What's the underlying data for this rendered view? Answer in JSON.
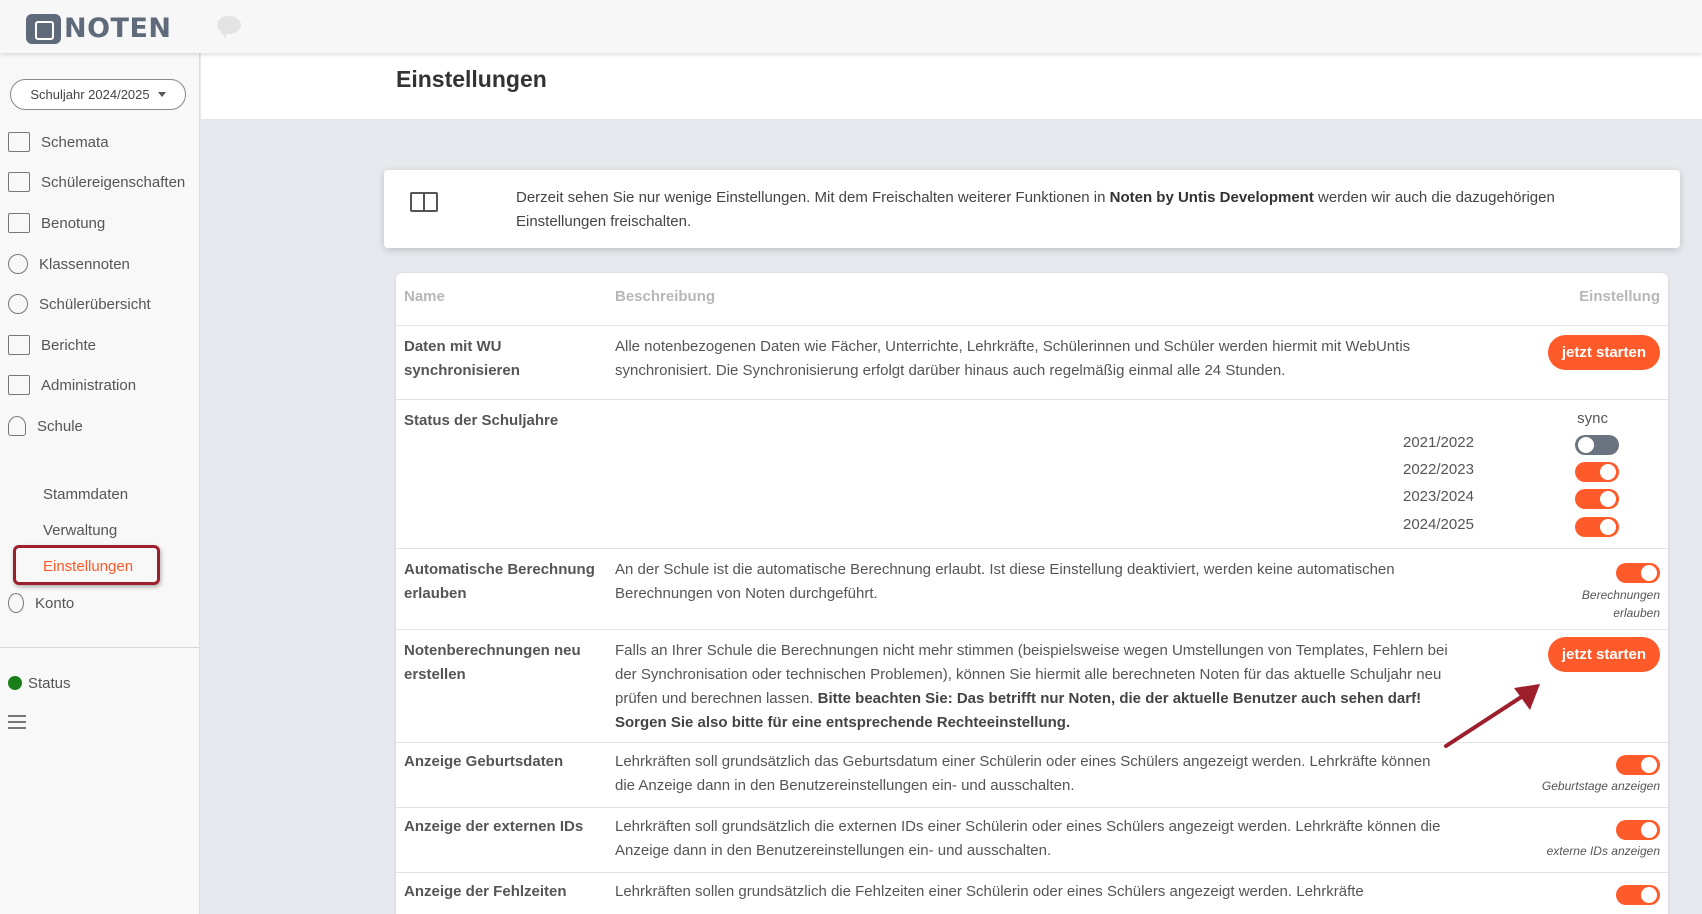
{
  "app": {
    "logo_text": "NOTEN"
  },
  "sidebar": {
    "school_year": "Schuljahr 2024/2025",
    "items": [
      {
        "label": "Schemata",
        "icon": "schemata-icon"
      },
      {
        "label": "Schülereigenschaften",
        "icon": "student-properties-icon"
      },
      {
        "label": "Benotung",
        "icon": "grading-icon"
      },
      {
        "label": "Klassennoten",
        "icon": "class-grades-icon"
      },
      {
        "label": "Schülerübersicht",
        "icon": "student-overview-icon"
      },
      {
        "label": "Berichte",
        "icon": "reports-icon"
      },
      {
        "label": "Administration",
        "icon": "administration-icon"
      },
      {
        "label": "Schule",
        "icon": "school-icon"
      }
    ],
    "sub_items": [
      "Stammdaten",
      "Verwaltung",
      "Einstellungen"
    ],
    "account": "Konto",
    "status": "Status",
    "status_color": "#1a7f1a"
  },
  "page": {
    "title": "Einstellungen",
    "info_text_1": "Derzeit sehen Sie nur wenige Einstellungen. Mit dem Freischalten weiterer Funktionen in ",
    "info_text_bold": "Noten by Untis Development",
    "info_text_2": " werden wir auch die dazugehörigen Einstellungen freischalten."
  },
  "table": {
    "headers": {
      "name": "Name",
      "description": "Beschreibung",
      "setting": "Einstellung"
    },
    "rows": [
      {
        "name": "Daten mit WU synchronisieren",
        "description": "Alle notenbezogenen Daten wie Fächer, Unterrichte, Lehrkräfte, Schülerinnen und Schüler werden hiermit mit WebUntis synchronisiert. Die Synchronisierung erfolgt darüber hinaus auch regelmäßig einmal alle 24 Stunden.",
        "button": "jetzt starten"
      },
      {
        "name": "Status der Schuljahre",
        "sync_label": "sync",
        "years": [
          {
            "year": "2021/2022",
            "on": false
          },
          {
            "year": "2022/2023",
            "on": true
          },
          {
            "year": "2023/2024",
            "on": true
          },
          {
            "year": "2024/2025",
            "on": true
          }
        ]
      },
      {
        "name": "Automatische Berechnung erlauben",
        "description": "An der Schule ist die automatische Berechnung erlaubt. Ist diese Einstellung deaktiviert, werden keine automatischen Berechnungen von Noten durchgeführt.",
        "toggle_label_1": "Berechnungen",
        "toggle_label_2": "erlauben",
        "on": true
      },
      {
        "name": "Notenberechnungen neu erstellen",
        "description": "Falls an Ihrer Schule die Berechnungen nicht mehr stimmen (beispielsweise wegen Umstellungen von Templates, Fehlern bei der Synchronisation oder technischen Problemen), können Sie hiermit alle berechneten Noten für das aktuelle Schuljahr neu prüfen und berechnen lassen. ",
        "description_bold": "Bitte beachten Sie: Das betrifft nur Noten, die der aktuelle Benutzer auch sehen darf! Sorgen Sie also bitte für eine entsprechende Rechteeinstellung.",
        "button": "jetzt starten"
      },
      {
        "name": "Anzeige Geburtsdaten",
        "description": "Lehrkräften soll grundsätzlich das Geburtsdatum einer Schülerin oder eines Schülers angezeigt werden. Lehrkräfte können die Anzeige dann in den Benutzereinstellungen ein- und ausschalten.",
        "toggle_label": "Geburtstage anzeigen",
        "on": true
      },
      {
        "name": "Anzeige der externen IDs",
        "description": "Lehrkräften soll grundsätzlich die externen IDs einer Schülerin oder eines Schülers angezeigt werden. Lehrkräfte können die Anzeige dann in den Benutzereinstellungen ein- und ausschalten.",
        "toggle_label": "externe IDs anzeigen",
        "on": true
      },
      {
        "name": "Anzeige der Fehlzeiten",
        "description": "Lehrkräften sollen grundsätzlich die Fehlzeiten einer Schülerin oder eines Schülers angezeigt werden. Lehrkräfte",
        "on": true
      }
    ]
  },
  "colors": {
    "accent": "#ff5a29",
    "highlight_box": "#9c1f2b",
    "toggle_off": "#6a7480"
  }
}
